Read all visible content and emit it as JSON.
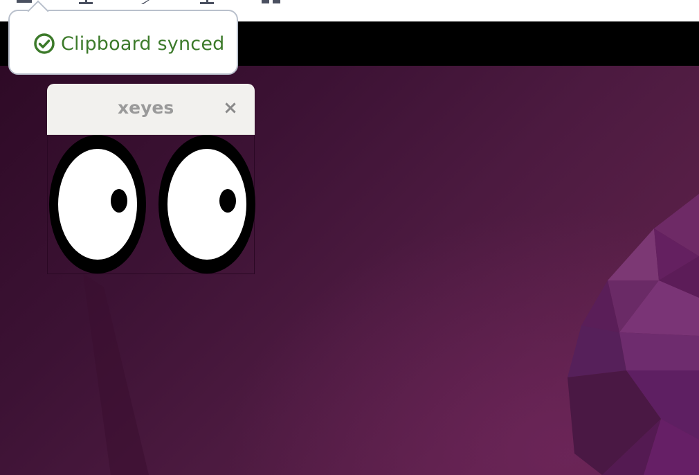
{
  "notification": {
    "message": "Clipboard synced",
    "icon": "check-circle-icon",
    "color": "#3c7a2a"
  },
  "toolbar": {
    "icons": [
      "menu-icon",
      "keyboard-icon",
      "back-icon",
      "upload-icon",
      "grid-icon"
    ]
  },
  "window": {
    "title": "xeyes",
    "close_label": "×"
  },
  "colors": {
    "wallpaper_dark": "#2e0a26",
    "wallpaper_light": "#5c2249",
    "accent_purple": "#7a3a7a"
  }
}
